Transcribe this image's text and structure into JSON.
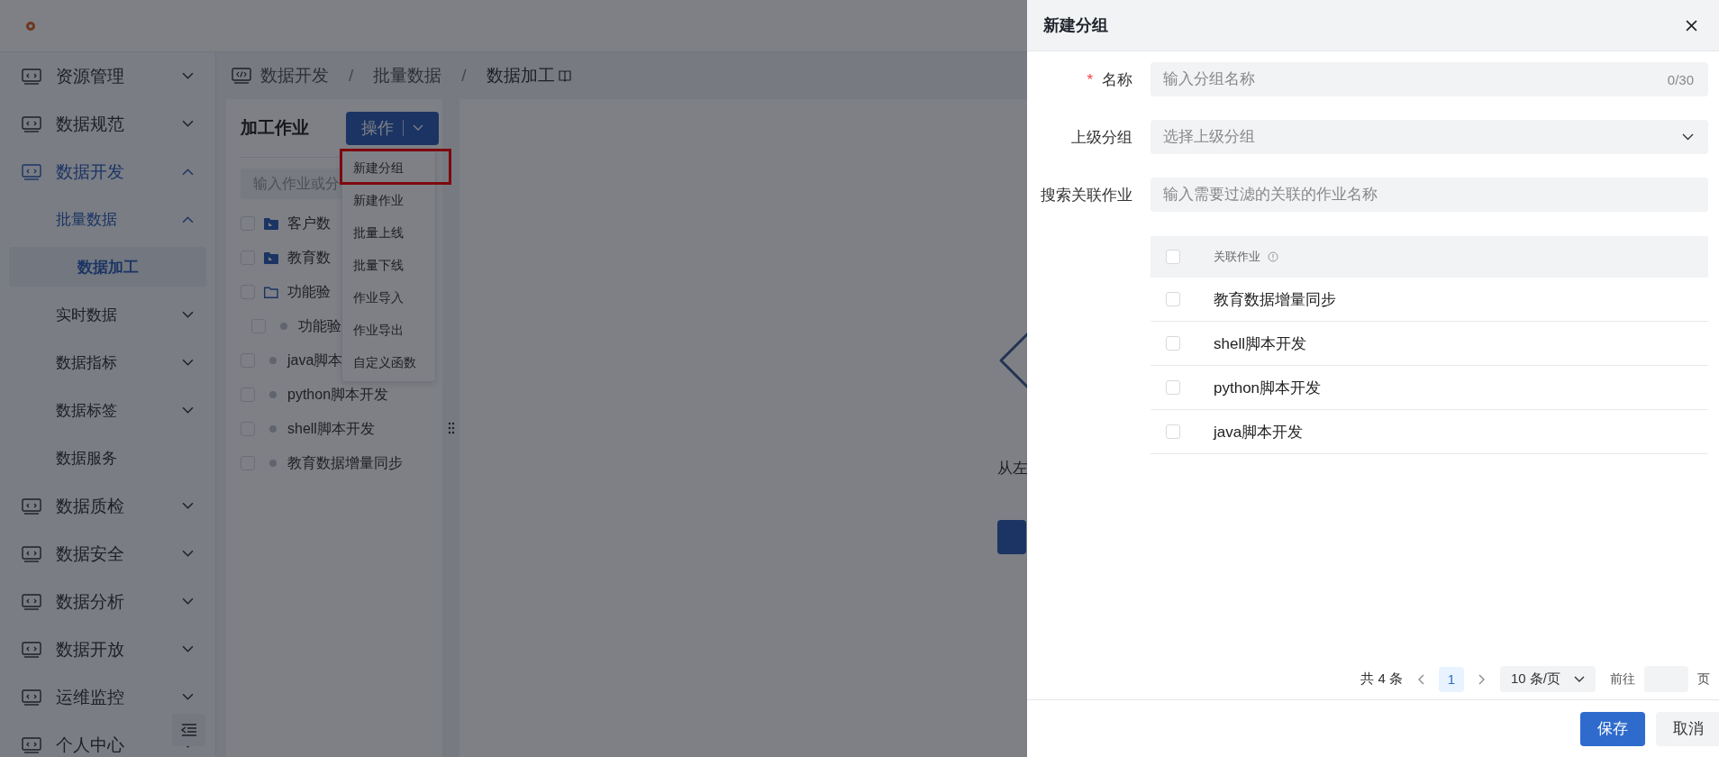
{
  "sidebar": {
    "items": [
      {
        "label": "资源管理",
        "kind": "group",
        "expanded": false
      },
      {
        "label": "数据规范",
        "kind": "group",
        "expanded": false
      },
      {
        "label": "数据开发",
        "kind": "group",
        "expanded": true,
        "children": [
          {
            "label": "批量数据",
            "kind": "group",
            "expanded": true,
            "children": [
              {
                "label": "数据加工",
                "kind": "link",
                "selected": true
              }
            ]
          },
          {
            "label": "实时数据",
            "kind": "group",
            "expanded": false
          },
          {
            "label": "数据指标",
            "kind": "group",
            "expanded": false
          },
          {
            "label": "数据标签",
            "kind": "group",
            "expanded": false
          },
          {
            "label": "数据服务",
            "kind": "link",
            "selected": false
          }
        ]
      },
      {
        "label": "数据质检",
        "kind": "group",
        "expanded": false
      },
      {
        "label": "数据安全",
        "kind": "group",
        "expanded": false
      },
      {
        "label": "数据分析",
        "kind": "group",
        "expanded": false
      },
      {
        "label": "数据开放",
        "kind": "group",
        "expanded": false
      },
      {
        "label": "运维监控",
        "kind": "group",
        "expanded": false
      },
      {
        "label": "个人中心",
        "kind": "group",
        "expanded": false
      }
    ]
  },
  "breadcrumb": {
    "separator": "/",
    "items": [
      "数据开发",
      "批量数据",
      "数据加工"
    ]
  },
  "job_panel": {
    "title": "加工作业",
    "action_button": "操作",
    "dropdown": [
      {
        "label": "新建分组",
        "marked": true
      },
      {
        "label": "新建作业",
        "marked": false
      },
      {
        "label": "批量上线",
        "marked": false
      },
      {
        "label": "批量下线",
        "marked": false
      },
      {
        "label": "作业导入",
        "marked": false
      },
      {
        "label": "作业导出",
        "marked": false
      },
      {
        "label": "自定义函数",
        "marked": false
      }
    ],
    "search": {
      "placeholder": "输入作业或分"
    },
    "tree": [
      {
        "label": "客户数",
        "kind": "folder",
        "expanded": false,
        "checked": false
      },
      {
        "label": "教育数",
        "kind": "folder",
        "expanded": false,
        "checked": false
      },
      {
        "label": "功能验",
        "kind": "folder",
        "expanded": true,
        "checked": false,
        "children": [
          {
            "label": "功能验",
            "kind": "job",
            "checked": false
          }
        ]
      },
      {
        "label": "java脚本",
        "kind": "job",
        "checked": false
      },
      {
        "label": "python脚本开发",
        "kind": "job",
        "checked": false
      },
      {
        "label": "shell脚本开发",
        "kind": "job",
        "checked": false
      },
      {
        "label": "教育数据增量同步",
        "kind": "job",
        "checked": false
      }
    ]
  },
  "empty_state": {
    "text": "从左"
  },
  "drawer": {
    "title": "新建分组",
    "required_mark": "*",
    "fields": [
      {
        "label": "名称",
        "kind": "input",
        "required": true,
        "placeholder": "输入分组名称",
        "counter": "0/30"
      },
      {
        "label": "上级分组",
        "kind": "select",
        "required": false,
        "placeholder": "选择上级分组"
      },
      {
        "label": "搜索关联作业",
        "kind": "input",
        "required": false,
        "placeholder": "输入需要过滤的关联的作业名称"
      }
    ],
    "table": {
      "header_checked": false,
      "column": "关联作业",
      "rows": [
        {
          "name": "教育数据增量同步",
          "checked": false
        },
        {
          "name": "shell脚本开发",
          "checked": false
        },
        {
          "name": "python脚本开发",
          "checked": false
        },
        {
          "name": "java脚本开发",
          "checked": false
        }
      ]
    },
    "pagination": {
      "total": "共 4 条",
      "pages": [
        {
          "label": "1",
          "selected": true
        }
      ],
      "page_size": "10 条/页",
      "goto_label": "前往",
      "goto_suffix": "页"
    },
    "buttons": [
      {
        "label": "保存",
        "kind": "primary"
      },
      {
        "label": "取消",
        "kind": "default"
      }
    ]
  }
}
